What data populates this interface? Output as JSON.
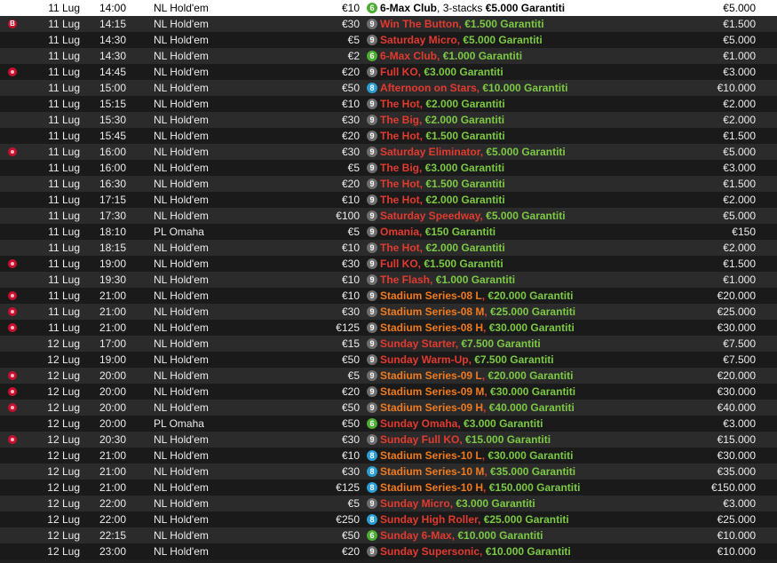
{
  "rows": [
    {
      "flag": "",
      "date": "11 Lug",
      "time": "14:00",
      "game": "NL Hold'em",
      "buyin": "€10",
      "seats": "6",
      "name": "6-Max Club",
      "name_color": "selected",
      "extra": "3-stacks",
      "gtd": "€5.000 Garantiti",
      "prize": "€5.000",
      "selected": true
    },
    {
      "flag": "B",
      "date": "11 Lug",
      "time": "14:15",
      "game": "NL Hold'em",
      "buyin": "€30",
      "seats": "9",
      "name": "Win The Button",
      "name_color": "red",
      "extra": "",
      "gtd": "€1.500 Garantiti",
      "prize": "€1.500"
    },
    {
      "flag": "",
      "date": "11 Lug",
      "time": "14:30",
      "game": "NL Hold'em",
      "buyin": "€5",
      "seats": "9",
      "name": "Saturday Micro",
      "name_color": "red",
      "extra": "",
      "gtd": "€5.000 Garantiti",
      "prize": "€5.000"
    },
    {
      "flag": "",
      "date": "11 Lug",
      "time": "14:30",
      "game": "NL Hold'em",
      "buyin": "€2",
      "seats": "6",
      "name": "6-Max Club",
      "name_color": "red",
      "extra": "",
      "gtd": "€1.000 Garantiti",
      "prize": "€1.000"
    },
    {
      "flag": "bounty",
      "date": "11 Lug",
      "time": "14:45",
      "game": "NL Hold'em",
      "buyin": "€20",
      "seats": "9",
      "name": "Full KO",
      "name_color": "red",
      "extra": "",
      "gtd": "€3.000 Garantiti",
      "prize": "€3.000"
    },
    {
      "flag": "",
      "date": "11 Lug",
      "time": "15:00",
      "game": "NL Hold'em",
      "buyin": "€50",
      "seats": "8",
      "name": "Afternoon on Stars",
      "name_color": "red",
      "extra": "",
      "gtd": "€10.000 Garantiti",
      "prize": "€10.000"
    },
    {
      "flag": "",
      "date": "11 Lug",
      "time": "15:15",
      "game": "NL Hold'em",
      "buyin": "€10",
      "seats": "9",
      "name": "The Hot",
      "name_color": "red",
      "extra": "",
      "gtd": "€2.000 Garantiti",
      "prize": "€2.000"
    },
    {
      "flag": "",
      "date": "11 Lug",
      "time": "15:30",
      "game": "NL Hold'em",
      "buyin": "€30",
      "seats": "9",
      "name": "The Big",
      "name_color": "red",
      "extra": "",
      "gtd": "€2.000 Garantiti",
      "prize": "€2.000"
    },
    {
      "flag": "",
      "date": "11 Lug",
      "time": "15:45",
      "game": "NL Hold'em",
      "buyin": "€20",
      "seats": "9",
      "name": "The Hot",
      "name_color": "red",
      "extra": "",
      "gtd": "€1.500 Garantiti",
      "prize": "€1.500"
    },
    {
      "flag": "bounty",
      "date": "11 Lug",
      "time": "16:00",
      "game": "NL Hold'em",
      "buyin": "€30",
      "seats": "9",
      "name": "Saturday Eliminator",
      "name_color": "red",
      "extra": "",
      "gtd": "€5.000 Garantiti",
      "prize": "€5.000"
    },
    {
      "flag": "",
      "date": "11 Lug",
      "time": "16:00",
      "game": "NL Hold'em",
      "buyin": "€5",
      "seats": "9",
      "name": "The Big",
      "name_color": "red",
      "extra": "",
      "gtd": "€3.000 Garantiti",
      "prize": "€3.000"
    },
    {
      "flag": "",
      "date": "11 Lug",
      "time": "16:30",
      "game": "NL Hold'em",
      "buyin": "€20",
      "seats": "9",
      "name": "The Hot",
      "name_color": "red",
      "extra": "",
      "gtd": "€1.500 Garantiti",
      "prize": "€1.500"
    },
    {
      "flag": "",
      "date": "11 Lug",
      "time": "17:15",
      "game": "NL Hold'em",
      "buyin": "€10",
      "seats": "9",
      "name": "The Hot",
      "name_color": "red",
      "extra": "",
      "gtd": "€2.000 Garantiti",
      "prize": "€2.000"
    },
    {
      "flag": "",
      "date": "11 Lug",
      "time": "17:30",
      "game": "NL Hold'em",
      "buyin": "€100",
      "seats": "9",
      "name": "Saturday Speedway",
      "name_color": "red",
      "extra": "",
      "gtd": "€5.000 Garantiti",
      "prize": "€5.000"
    },
    {
      "flag": "",
      "date": "11 Lug",
      "time": "18:10",
      "game": "PL Omaha",
      "buyin": "€5",
      "seats": "9",
      "name": "Omania",
      "name_color": "red",
      "extra": "",
      "gtd": "€150 Garantiti",
      "prize": "€150"
    },
    {
      "flag": "",
      "date": "11 Lug",
      "time": "18:15",
      "game": "NL Hold'em",
      "buyin": "€10",
      "seats": "9",
      "name": "The Hot",
      "name_color": "red",
      "extra": "",
      "gtd": "€2.000 Garantiti",
      "prize": "€2.000"
    },
    {
      "flag": "bounty",
      "date": "11 Lug",
      "time": "19:00",
      "game": "NL Hold'em",
      "buyin": "€30",
      "seats": "9",
      "name": "Full KO",
      "name_color": "red",
      "extra": "",
      "gtd": "€1.500 Garantiti",
      "prize": "€1.500"
    },
    {
      "flag": "",
      "date": "11 Lug",
      "time": "19:30",
      "game": "NL Hold'em",
      "buyin": "€10",
      "seats": "9",
      "name": "The Flash",
      "name_color": "red",
      "extra": "",
      "gtd": "€1.000 Garantiti",
      "prize": "€1.000"
    },
    {
      "flag": "bounty",
      "date": "11 Lug",
      "time": "21:00",
      "game": "NL Hold'em",
      "buyin": "€10",
      "seats": "9",
      "name": "Stadium Series-08 L",
      "name_color": "orange",
      "extra": "",
      "gtd": "€20.000 Garantiti",
      "prize": "€20.000"
    },
    {
      "flag": "bounty",
      "date": "11 Lug",
      "time": "21:00",
      "game": "NL Hold'em",
      "buyin": "€30",
      "seats": "9",
      "name": "Stadium Series-08 M",
      "name_color": "orange",
      "extra": "",
      "gtd": "€25.000 Garantiti",
      "prize": "€25.000"
    },
    {
      "flag": "bounty",
      "date": "11 Lug",
      "time": "21:00",
      "game": "NL Hold'em",
      "buyin": "€125",
      "seats": "9",
      "name": "Stadium Series-08 H",
      "name_color": "orange",
      "extra": "",
      "gtd": "€30.000 Garantiti",
      "prize": "€30.000"
    },
    {
      "flag": "",
      "date": "12 Lug",
      "time": "17:00",
      "game": "NL Hold'em",
      "buyin": "€15",
      "seats": "9",
      "name": "Sunday Starter",
      "name_color": "red",
      "extra": "",
      "gtd": "€7.500 Garantiti",
      "prize": "€7.500"
    },
    {
      "flag": "",
      "date": "12 Lug",
      "time": "19:00",
      "game": "NL Hold'em",
      "buyin": "€50",
      "seats": "9",
      "name": "Sunday Warm-Up",
      "name_color": "red",
      "extra": "",
      "gtd": "€7.500 Garantiti",
      "prize": "€7.500"
    },
    {
      "flag": "bounty",
      "date": "12 Lug",
      "time": "20:00",
      "game": "NL Hold'em",
      "buyin": "€5",
      "seats": "9",
      "name": "Stadium Series-09 L",
      "name_color": "orange",
      "extra": "",
      "gtd": "€20.000 Garantiti",
      "prize": "€20.000"
    },
    {
      "flag": "bounty",
      "date": "12 Lug",
      "time": "20:00",
      "game": "NL Hold'em",
      "buyin": "€20",
      "seats": "9",
      "name": "Stadium Series-09 M",
      "name_color": "orange",
      "extra": "",
      "gtd": "€30.000 Garantiti",
      "prize": "€30.000"
    },
    {
      "flag": "bounty",
      "date": "12 Lug",
      "time": "20:00",
      "game": "NL Hold'em",
      "buyin": "€50",
      "seats": "9",
      "name": "Stadium Series-09 H",
      "name_color": "orange",
      "extra": "",
      "gtd": "€40.000 Garantiti",
      "prize": "€40.000"
    },
    {
      "flag": "",
      "date": "12 Lug",
      "time": "20:00",
      "game": "PL Omaha",
      "buyin": "€50",
      "seats": "6",
      "name": "Sunday Omaha",
      "name_color": "red",
      "extra": "",
      "gtd": "€3.000 Garantiti",
      "prize": "€3.000"
    },
    {
      "flag": "bounty",
      "date": "12 Lug",
      "time": "20:30",
      "game": "NL Hold'em",
      "buyin": "€30",
      "seats": "9",
      "name": "Sunday Full KO",
      "name_color": "red",
      "extra": "",
      "gtd": "€15.000 Garantiti",
      "prize": "€15.000"
    },
    {
      "flag": "",
      "date": "12 Lug",
      "time": "21:00",
      "game": "NL Hold'em",
      "buyin": "€10",
      "seats": "8",
      "name": "Stadium Series-10 L",
      "name_color": "orange",
      "extra": "",
      "gtd": "€30.000 Garantiti",
      "prize": "€30.000"
    },
    {
      "flag": "",
      "date": "12 Lug",
      "time": "21:00",
      "game": "NL Hold'em",
      "buyin": "€30",
      "seats": "8",
      "name": "Stadium Series-10 M",
      "name_color": "orange",
      "extra": "",
      "gtd": "€35.000 Garantiti",
      "prize": "€35.000"
    },
    {
      "flag": "",
      "date": "12 Lug",
      "time": "21:00",
      "game": "NL Hold'em",
      "buyin": "€125",
      "seats": "8",
      "name": "Stadium Series-10 H",
      "name_color": "orange",
      "extra": "",
      "gtd": "€150.000 Garantiti",
      "prize": "€150.000"
    },
    {
      "flag": "",
      "date": "12 Lug",
      "time": "22:00",
      "game": "NL Hold'em",
      "buyin": "€5",
      "seats": "9",
      "name": "Sunday Micro",
      "name_color": "red",
      "extra": "",
      "gtd": "€3.000 Garantiti",
      "prize": "€3.000"
    },
    {
      "flag": "",
      "date": "12 Lug",
      "time": "22:00",
      "game": "NL Hold'em",
      "buyin": "€250",
      "seats": "8",
      "name": "Sunday High Roller",
      "name_color": "red",
      "extra": "",
      "gtd": "€25.000 Garantiti",
      "prize": "€25.000"
    },
    {
      "flag": "",
      "date": "12 Lug",
      "time": "22:15",
      "game": "NL Hold'em",
      "buyin": "€50",
      "seats": "6",
      "name": "Sunday 6-Max",
      "name_color": "red",
      "extra": "",
      "gtd": "€10.000 Garantiti",
      "prize": "€10.000"
    },
    {
      "flag": "",
      "date": "12 Lug",
      "time": "23:00",
      "game": "NL Hold'em",
      "buyin": "€20",
      "seats": "9",
      "name": "Sunday Supersonic",
      "name_color": "red",
      "extra": "",
      "gtd": "€10.000 Garantiti",
      "prize": "€10.000"
    }
  ],
  "colors": {
    "name_red": "#e23a2e",
    "name_orange": "#f07a1c",
    "guarantee_green": "#7cc943",
    "seat9": "#6e6e6e",
    "seat6": "#4caf32",
    "seat8": "#2a9fd6",
    "flag": "#c8102e"
  }
}
